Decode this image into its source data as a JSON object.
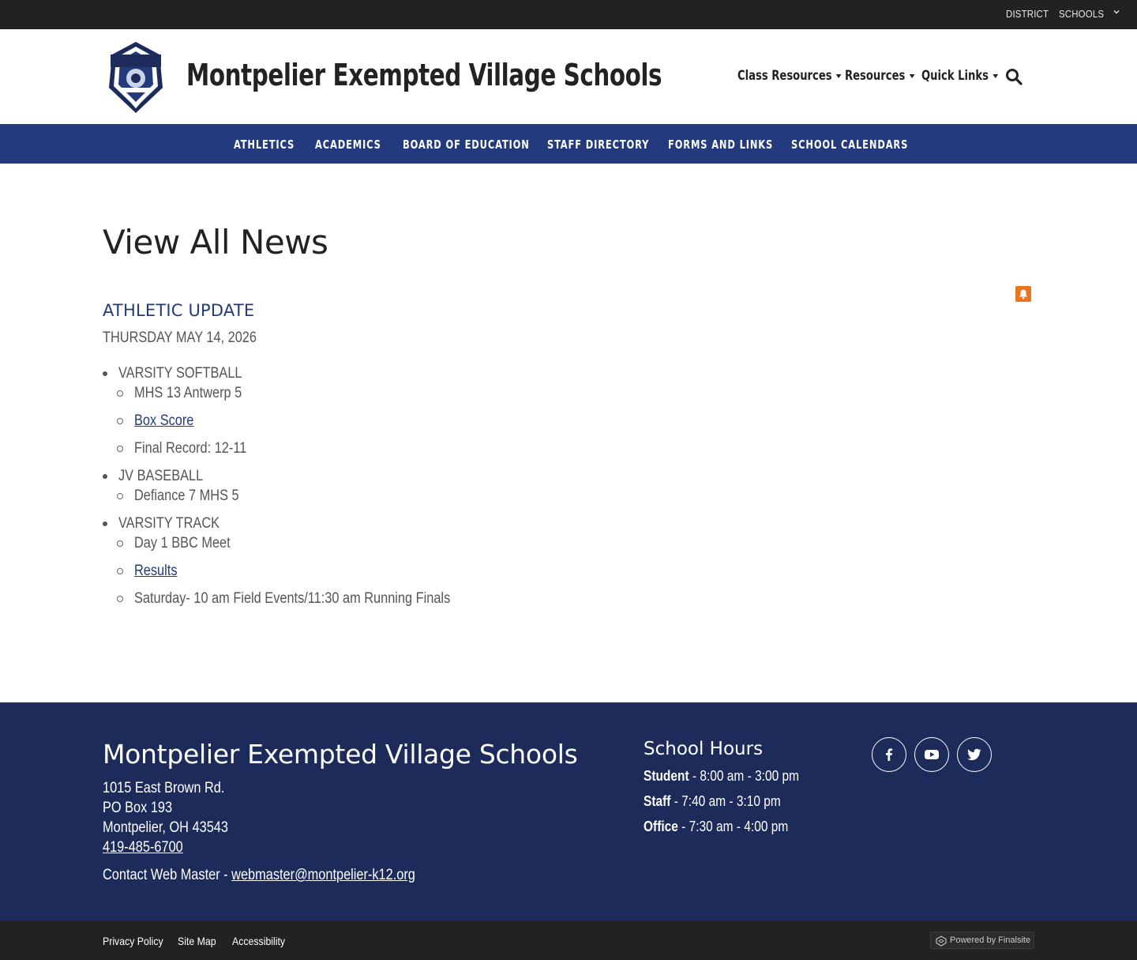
{
  "utility": {
    "district": "DISTRICT",
    "schools": "SCHOOLS"
  },
  "header": {
    "site_title": "Montpelier Exempted Village Schools",
    "nav": {
      "class_resources": "Class Resources",
      "resources": "Resources",
      "quick_links": "Quick Links"
    }
  },
  "main_nav": {
    "items": [
      "ATHLETICS",
      "ACADEMICS",
      "BOARD OF EDUCATION",
      "STAFF DIRECTORY",
      "FORMS AND LINKS",
      "SCHOOL CALENDARS"
    ]
  },
  "content": {
    "page_title": "View All News",
    "news": {
      "title": "ATHLETIC UPDATE",
      "date": "THURSDAY MAY 14, 2026",
      "sections": [
        {
          "heading": "VARSITY SOFTBALL",
          "items": [
            "MHS 13 Antwerp 5",
            "Box Score",
            "Final Record: 12-11"
          ]
        },
        {
          "heading": "JV BASEBALL",
          "items": [
            "Defiance 7 MHS 5"
          ]
        },
        {
          "heading": "VARSITY TRACK",
          "items": [
            "Day 1 BBC Meet",
            "Results",
            "Saturday- 10 am Field Events/11:30 am Running Finals"
          ]
        }
      ]
    }
  },
  "footer": {
    "title": "Montpelier Exempted Village Schools",
    "address1": "1015 East Brown Rd.",
    "address2": "PO Box 193",
    "address3": "Montpelier, OH  43543",
    "phone": "419-485-6700",
    "contact_label": "Contact Web Master - ",
    "contact_email": "webmaster@montpelier-k12.org",
    "hours_title": "School Hours",
    "hours": [
      {
        "label": "Student",
        "value": " - 8:00 am - 3:00 pm"
      },
      {
        "label": "Staff",
        "value": " - 7:40 am - 3:10 pm"
      },
      {
        "label": "Office",
        "value": " - 7:30 am - 4:00 pm"
      }
    ]
  },
  "bottom": {
    "privacy": "Privacy Policy",
    "sitemap": "Site Map",
    "accessibility": "Accessibility",
    "powered": "Powered by Finalsite"
  },
  "colors": {
    "nav_blue": "#233a7c",
    "footer_navy": "#1c2b5a",
    "notify_orange": "#e8761e",
    "dark_bar": "#222222"
  }
}
